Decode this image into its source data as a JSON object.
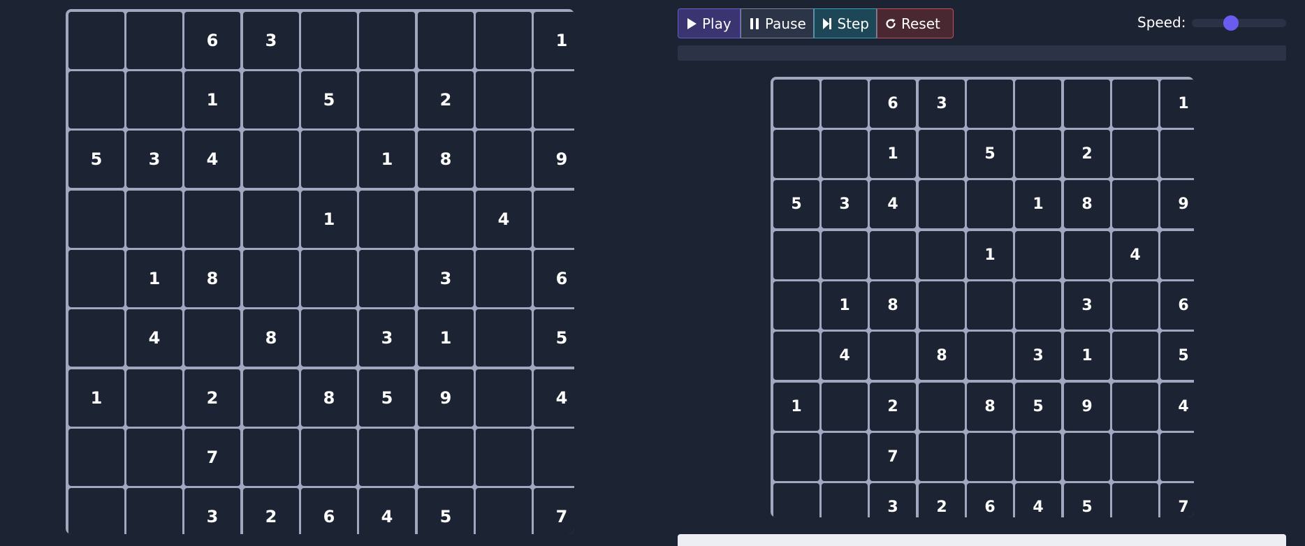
{
  "controls": {
    "play_label": "Play",
    "pause_label": "Pause",
    "step_label": "Step",
    "reset_label": "Reset",
    "speed_label": "Speed:",
    "speed_value": 0.4,
    "progress": 0
  },
  "icons": {
    "play": "play-icon",
    "pause": "pause-icon",
    "step": "step-forward-icon",
    "reset": "reset-icon"
  },
  "colors": {
    "background": "#1c2333",
    "grid_line": "#a0a8c0",
    "accent": "#6b5cf0",
    "play_bg": "#3a3470",
    "pause_bg": "#2c3447",
    "step_bg": "#1d4656",
    "reset_bg": "#4a2832"
  },
  "puzzle": [
    [
      "",
      "",
      "6",
      "3",
      "",
      "",
      "",
      "",
      "1"
    ],
    [
      "",
      "",
      "1",
      "",
      "5",
      "",
      "2",
      "",
      ""
    ],
    [
      "5",
      "3",
      "4",
      "",
      "",
      "1",
      "8",
      "",
      "9"
    ],
    [
      "",
      "",
      "",
      "",
      "1",
      "",
      "",
      "4",
      ""
    ],
    [
      "",
      "1",
      "8",
      "",
      "",
      "",
      "3",
      "",
      "6"
    ],
    [
      "",
      "4",
      "",
      "8",
      "",
      "3",
      "1",
      "",
      "5"
    ],
    [
      "1",
      "",
      "2",
      "",
      "8",
      "5",
      "9",
      "",
      "4"
    ],
    [
      "",
      "",
      "7",
      "",
      "",
      "",
      "",
      "",
      ""
    ],
    [
      "",
      "",
      "3",
      "2",
      "6",
      "4",
      "5",
      "",
      "7"
    ]
  ],
  "solver_grid": [
    [
      "",
      "",
      "6",
      "3",
      "",
      "",
      "",
      "",
      "1"
    ],
    [
      "",
      "",
      "1",
      "",
      "5",
      "",
      "2",
      "",
      ""
    ],
    [
      "5",
      "3",
      "4",
      "",
      "",
      "1",
      "8",
      "",
      "9"
    ],
    [
      "",
      "",
      "",
      "",
      "1",
      "",
      "",
      "4",
      ""
    ],
    [
      "",
      "1",
      "8",
      "",
      "",
      "",
      "3",
      "",
      "6"
    ],
    [
      "",
      "4",
      "",
      "8",
      "",
      "3",
      "1",
      "",
      "5"
    ],
    [
      "1",
      "",
      "2",
      "",
      "8",
      "5",
      "9",
      "",
      "4"
    ],
    [
      "",
      "",
      "7",
      "",
      "",
      "",
      "",
      "",
      ""
    ],
    [
      "",
      "",
      "3",
      "2",
      "6",
      "4",
      "5",
      "",
      "7"
    ]
  ]
}
